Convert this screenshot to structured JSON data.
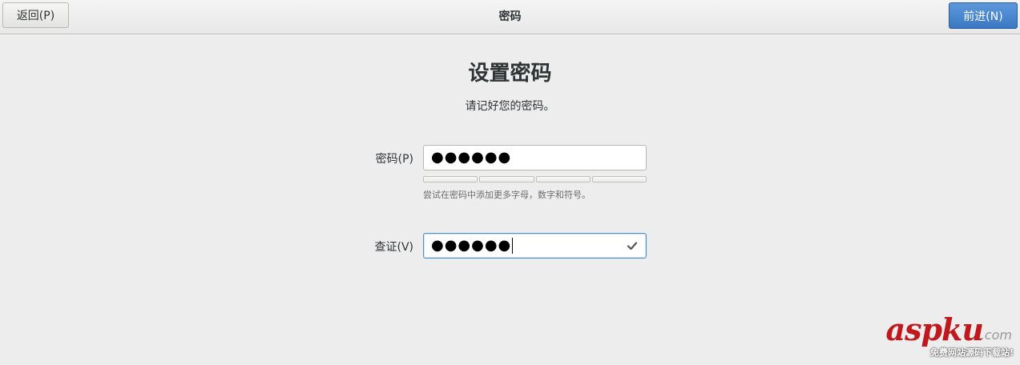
{
  "header": {
    "back_label": "返回(P)",
    "title": "密码",
    "next_label": "前进(N)"
  },
  "main": {
    "title": "设置密码",
    "subtitle": "请记好您的密码。",
    "password": {
      "label": "密码(P)",
      "value": "●●●●●●"
    },
    "strength": {
      "segments": 4,
      "level": 0
    },
    "hint": "尝试在密码中添加更多字母，数字和符号。",
    "confirm": {
      "label": "查证(V)",
      "value": "●●●●●●",
      "status_icon": "check-icon"
    }
  },
  "watermark": {
    "main": "aspku",
    "suffix": ".com",
    "sub": "免费网站源码下载站!"
  },
  "colors": {
    "accent": "#3b78c2",
    "background": "#ededed",
    "watermark": "#c0181c"
  }
}
